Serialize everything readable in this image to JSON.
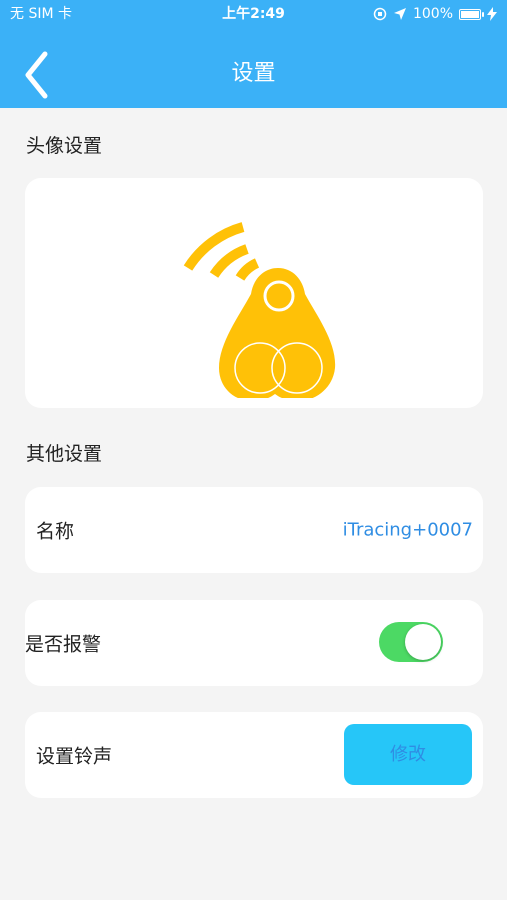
{
  "status_bar": {
    "carrier": "无 SIM 卡",
    "time": "上午2:49",
    "battery_percent": "100%"
  },
  "nav": {
    "title": "设置",
    "back_icon": "chevron-left-icon"
  },
  "sections": {
    "avatar_title": "头像设置",
    "other_title": "其他设置"
  },
  "avatar": {
    "icon": "tracker-tag-icon",
    "color": "#ffc107"
  },
  "settings": {
    "name_label": "名称",
    "name_value": "iTracing+0007",
    "alarm_label": "是否报警",
    "alarm_enabled": true,
    "ringtone_label": "设置铃声",
    "ringtone_button": "修改"
  },
  "colors": {
    "header": "#3bb1f7",
    "toggle_on": "#4cd964",
    "modify_button": "#26c6f8",
    "link": "#2f8de3"
  }
}
